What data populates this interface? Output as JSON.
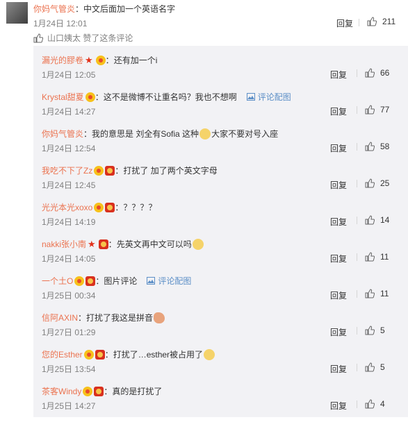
{
  "top": {
    "user": "你妈气管炎",
    "sep": "：",
    "text": "中文后面加一个英语名字",
    "time": "1月24日 12:01",
    "reply": "回复",
    "likes": "211",
    "liked_by": "山口姨太 赞了这条评论"
  },
  "comments": [
    {
      "user": "漏光的膠卷",
      "sep": "：",
      "text": "还有加一个i",
      "time": "1月24日 12:05",
      "reply": "回复",
      "likes": "66"
    },
    {
      "user": "Krystal甜夏",
      "sep": "：",
      "text": "这不是微博不让重名吗？我也不想啊",
      "link": "评论配图",
      "time": "1月24日 14:27",
      "reply": "回复",
      "likes": "77"
    },
    {
      "user": "你妈气管炎",
      "sep": "：",
      "text": "我的意思是 刘全有Sofia 这种",
      "text2": "大家不要对号入座",
      "time": "1月24日 12:54",
      "reply": "回复",
      "likes": "58"
    },
    {
      "user": "我吃不下了Zz",
      "sep": "：",
      "text": "打扰了 加了两个英文字母",
      "time": "1月24日 12:45",
      "reply": "回复",
      "likes": "25"
    },
    {
      "user": "光光本光xoxo",
      "sep": "：",
      "text": "？？？？",
      "time": "1月24日 14:19",
      "reply": "回复",
      "likes": "14"
    },
    {
      "user": "nakki张小南",
      "sep": "：",
      "text": "先英文再中文可以吗",
      "time": "1月24日 14:05",
      "reply": "回复",
      "likes": "11"
    },
    {
      "user": "一个土O",
      "sep": "：",
      "text": "图片评论",
      "link": "评论配图",
      "time": "1月25日 00:34",
      "reply": "回复",
      "likes": "11"
    },
    {
      "user": "信阿AXIN",
      "sep": "：",
      "text": "打扰了我这是拼音",
      "time": "1月27日 01:29",
      "reply": "回复",
      "likes": "5"
    },
    {
      "user": "您的Esther",
      "sep": "：",
      "text": "打扰了…esther被占用了",
      "time": "1月25日 13:54",
      "reply": "回复",
      "likes": "5"
    },
    {
      "user": "茶客Windy",
      "sep": "：",
      "text": "真的是打扰了",
      "time": "1月25日 14:27",
      "reply": "回复",
      "likes": "4"
    }
  ],
  "colors": {
    "username": "#eb7350",
    "link": "#5c8fc7",
    "box_bg": "#f2f2f5"
  },
  "icons": {
    "like": "thumb-up-icon",
    "picture": "picture-icon",
    "star": "star-badge-icon"
  }
}
